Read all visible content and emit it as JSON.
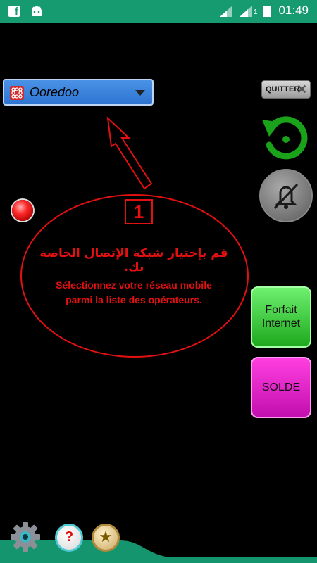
{
  "status_bar": {
    "time": "01:49",
    "sim_label": "1",
    "icons": [
      "facebook-icon",
      "android-icon",
      "signal-icon",
      "signal-icon",
      "battery-icon"
    ],
    "background_color": "#169a70"
  },
  "operator_select": {
    "selected": "Ooredoo",
    "icon": "ooredoo-logo-icon"
  },
  "toolbar": {
    "quit_label": "QUITTER",
    "quit_icon": "close-icon",
    "refresh_icon": "refresh-icon",
    "mute_icon": "mute-icon"
  },
  "status_led": {
    "color": "#ff2a2a"
  },
  "guide": {
    "step_number": "1",
    "arabic_text": "قم بإختيار شبكة الإتصال الخاصة بك.",
    "french_line1": "Sélectionnez votre réseau mobile",
    "french_line2": "parmi la liste des opérateurs.",
    "color": "#e21010"
  },
  "actions": {
    "forfait_line1": "Forfait",
    "forfait_line2": "Internet",
    "solde_label": "SOLDE",
    "forfait_color": "#3fd43f",
    "solde_color": "#ee2bd6"
  },
  "bottom_bar": {
    "icons": [
      "gear-icon",
      "help-icon",
      "star-icon"
    ],
    "help_glyph": "?",
    "star_glyph": "★"
  }
}
